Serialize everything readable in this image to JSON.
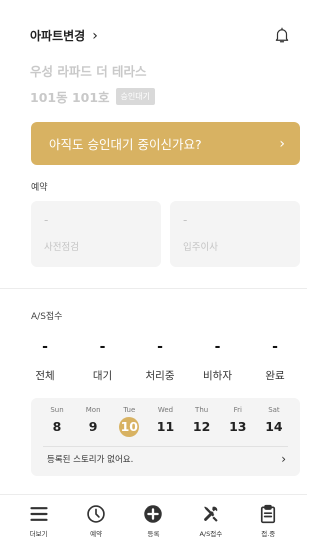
{
  "header": {
    "apartment_change_label": "아파트변경",
    "apartment_name": "우성 라파드 더 테라스",
    "unit": "101동 101호",
    "status_badge": "승인대기"
  },
  "pending_banner": {
    "text": "아직도 승인대기 중이신가요?"
  },
  "reservation": {
    "section_label": "예약",
    "cards": [
      {
        "value": "-",
        "title": "사전점검"
      },
      {
        "value": "-",
        "title": "입주이사"
      }
    ]
  },
  "as_section": {
    "section_label": "A/S접수",
    "statuses": [
      {
        "count": "-",
        "label": "전체"
      },
      {
        "count": "-",
        "label": "대기"
      },
      {
        "count": "-",
        "label": "처리중"
      },
      {
        "count": "-",
        "label": "비하자"
      },
      {
        "count": "-",
        "label": "완료"
      }
    ]
  },
  "calendar": {
    "days": [
      {
        "dow": "Sun",
        "date": "8"
      },
      {
        "dow": "Mon",
        "date": "9"
      },
      {
        "dow": "Tue",
        "date": "10",
        "selected": true
      },
      {
        "dow": "Wed",
        "date": "11"
      },
      {
        "dow": "Thu",
        "date": "12"
      },
      {
        "dow": "Fri",
        "date": "13"
      },
      {
        "dow": "Sat",
        "date": "14"
      }
    ],
    "story_text": "등록된 스토리가 없어요."
  },
  "bottom_nav": {
    "items": [
      {
        "label": "더보기",
        "icon": "menu-icon"
      },
      {
        "label": "예약",
        "icon": "clock-icon"
      },
      {
        "label": "등록",
        "icon": "plus-circle-icon"
      },
      {
        "label": "A/S접수",
        "icon": "tools-icon"
      },
      {
        "label": "접.중",
        "icon": "clipboard-icon"
      }
    ]
  },
  "colors": {
    "accent": "#d8b262",
    "muted_text": "#c9c9c9",
    "card_bg": "#f4f4f4"
  }
}
